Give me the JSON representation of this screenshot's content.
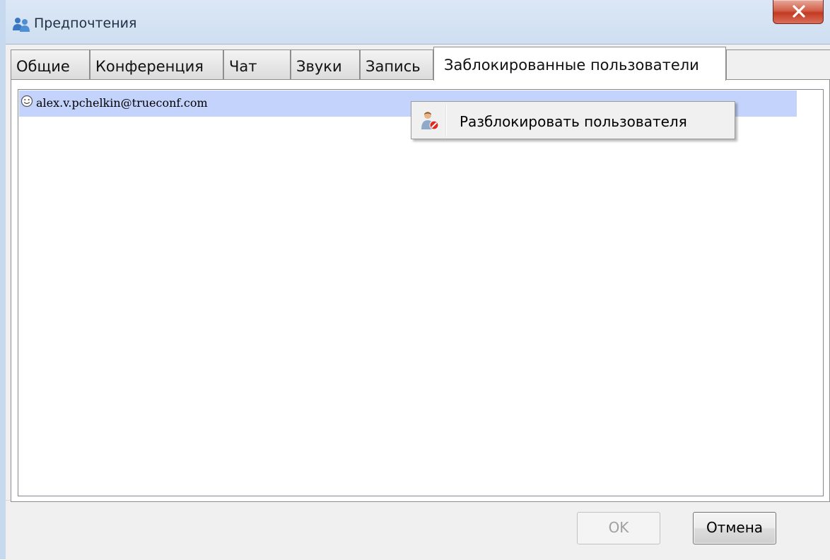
{
  "window": {
    "title": "Предпочтения",
    "close_symbol": "✕",
    "icon": "users-icon"
  },
  "tabs": [
    {
      "label": "Общие",
      "active": false
    },
    {
      "label": "Конференция",
      "active": false
    },
    {
      "label": "Чат",
      "active": false
    },
    {
      "label": "Звуки",
      "active": false
    },
    {
      "label": "Запись",
      "active": false
    },
    {
      "label": "Заблокированные пользователи",
      "active": true
    }
  ],
  "blocked_list": {
    "items": [
      {
        "icon": "smiley-icon",
        "text": "alex.v.pchelkin@trueconf.com",
        "selected": true
      }
    ]
  },
  "context_menu": {
    "items": [
      {
        "icon": "unblock-user-icon",
        "label": "Разблокировать пользователя"
      }
    ]
  },
  "buttons": {
    "ok": {
      "label": "OK",
      "enabled": false
    },
    "cancel": {
      "label": "Отмена",
      "enabled": true
    }
  },
  "colors": {
    "selection": "#c4d3fb",
    "close_button": "#c43a22",
    "title_bar": "#cfdff1"
  }
}
